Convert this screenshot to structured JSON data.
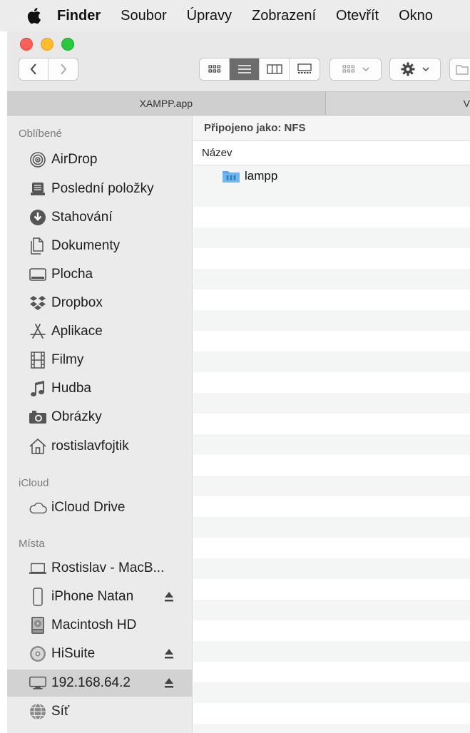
{
  "menubar": {
    "items": [
      "Finder",
      "Soubor",
      "Úpravy",
      "Zobrazení",
      "Otevřít",
      "Okno"
    ]
  },
  "window": {
    "tabs": [
      "XAMPP.app",
      "V"
    ],
    "path_bar": "Připojeno jako: NFS",
    "column_header": "Název",
    "files": [
      {
        "name": "lampp",
        "icon": "shared-folder-icon",
        "color": "#5aa9e6"
      }
    ]
  },
  "sidebar": {
    "sections": [
      {
        "title": "Oblíbené",
        "items": [
          {
            "label": "AirDrop",
            "icon": "airdrop-icon"
          },
          {
            "label": "Poslední položky",
            "icon": "recents-icon"
          },
          {
            "label": "Stahování",
            "icon": "downloads-icon"
          },
          {
            "label": "Dokumenty",
            "icon": "documents-icon"
          },
          {
            "label": "Plocha",
            "icon": "desktop-icon"
          },
          {
            "label": "Dropbox",
            "icon": "dropbox-icon"
          },
          {
            "label": "Aplikace",
            "icon": "applications-icon"
          },
          {
            "label": "Filmy",
            "icon": "movies-icon"
          },
          {
            "label": "Hudba",
            "icon": "music-icon"
          },
          {
            "label": "Obrázky",
            "icon": "pictures-icon"
          },
          {
            "label": "rostislavfojtik",
            "icon": "home-icon"
          }
        ]
      },
      {
        "title": "iCloud",
        "items": [
          {
            "label": "iCloud Drive",
            "icon": "icloud-icon"
          }
        ]
      },
      {
        "title": "Místa",
        "items": [
          {
            "label": "Rostislav - MacB...",
            "icon": "laptop-icon"
          },
          {
            "label": "iPhone Natan",
            "icon": "iphone-icon",
            "eject": true
          },
          {
            "label": "Macintosh HD",
            "icon": "hard-drive-icon"
          },
          {
            "label": "HiSuite",
            "icon": "disc-icon",
            "eject": true
          },
          {
            "label": "192.168.64.2",
            "icon": "network-display-icon",
            "eject": true,
            "selected": true
          },
          {
            "label": "Síť",
            "icon": "network-globe-icon"
          }
        ]
      }
    ]
  },
  "colors": {
    "selected_row": "#d2d2d2",
    "sidebar_bg": "#ebebeb",
    "folder_blue": "#5aa9e6",
    "traffic_close": "#fe5f57",
    "traffic_min": "#febc2e",
    "traffic_max": "#28c840"
  }
}
